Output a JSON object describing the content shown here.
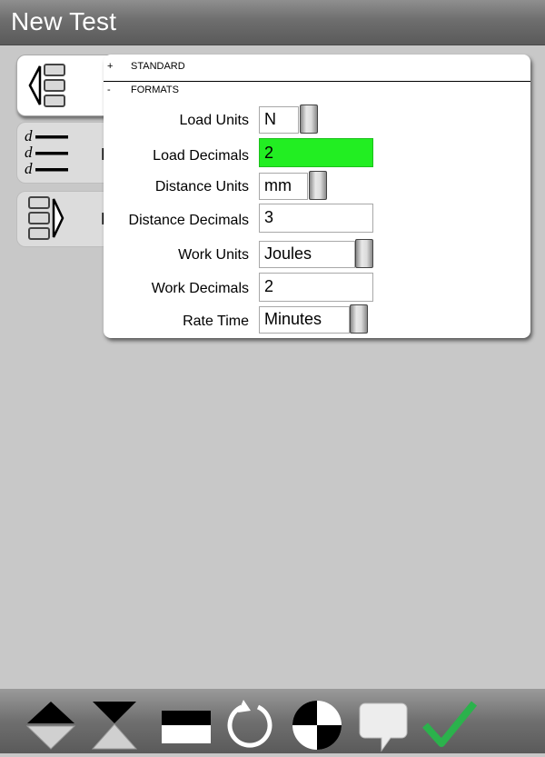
{
  "window": {
    "title": "New Test"
  },
  "sections": [
    {
      "sign": "+",
      "name": "STANDARD"
    },
    {
      "sign": "-",
      "name": "FORMATS"
    }
  ],
  "fields": [
    {
      "label": "Load Units",
      "value": "N",
      "type": "select",
      "highlighted": false
    },
    {
      "label": "Load Decimals",
      "value": "2",
      "type": "text",
      "highlighted": true
    },
    {
      "label": "Distance Units",
      "value": "mm",
      "type": "select",
      "highlighted": false
    },
    {
      "label": "Distance Decimals",
      "value": "3",
      "type": "text",
      "highlighted": false
    },
    {
      "label": "Work Units",
      "value": "Joules",
      "type": "select",
      "highlighted": false
    },
    {
      "label": "Work Decimals",
      "value": "2",
      "type": "text",
      "highlighted": false
    },
    {
      "label": "Rate Time",
      "value": "Minutes",
      "type": "select",
      "highlighted": false
    }
  ],
  "side_tabs": [
    {
      "icon": "list-collapse-icon",
      "label": ""
    },
    {
      "icon": "decimal-format-icon",
      "label": "D"
    },
    {
      "icon": "list-expand-icon",
      "label": "F"
    }
  ],
  "toolbar": {
    "icons": [
      "move-up-down-icon",
      "hourglass-icon",
      "window-icon",
      "refresh-icon",
      "zero-target-icon",
      "comment-icon",
      "accept-check-icon"
    ]
  },
  "colors": {
    "highlight": "#22ee22",
    "background": "#c8c8c8",
    "check": "#2bb24c"
  }
}
